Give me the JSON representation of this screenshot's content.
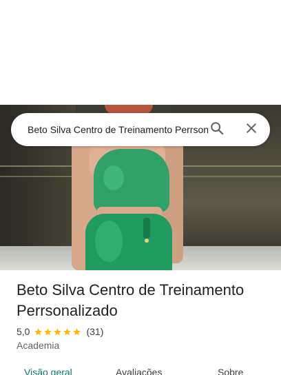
{
  "search": {
    "query": "Beto Silva Centro de Treinamento Perrsonalizado"
  },
  "hero": {
    "icons": [
      "search-icon",
      "close-icon"
    ]
  },
  "place": {
    "name": "Beto Silva Centro de Treinamento Perrsonalizado",
    "rating": "5,0",
    "stars": 5,
    "review_count": "(31)",
    "category": "Academia",
    "star_color": "#fbbc04"
  },
  "tabs": [
    {
      "label": "Visão geral",
      "active": true
    },
    {
      "label": "Avaliações",
      "active": false
    },
    {
      "label": "Sobre",
      "active": false
    }
  ],
  "colors": {
    "accent": "#0b7a6b",
    "text_primary": "#202124",
    "text_secondary": "#5f6368"
  }
}
